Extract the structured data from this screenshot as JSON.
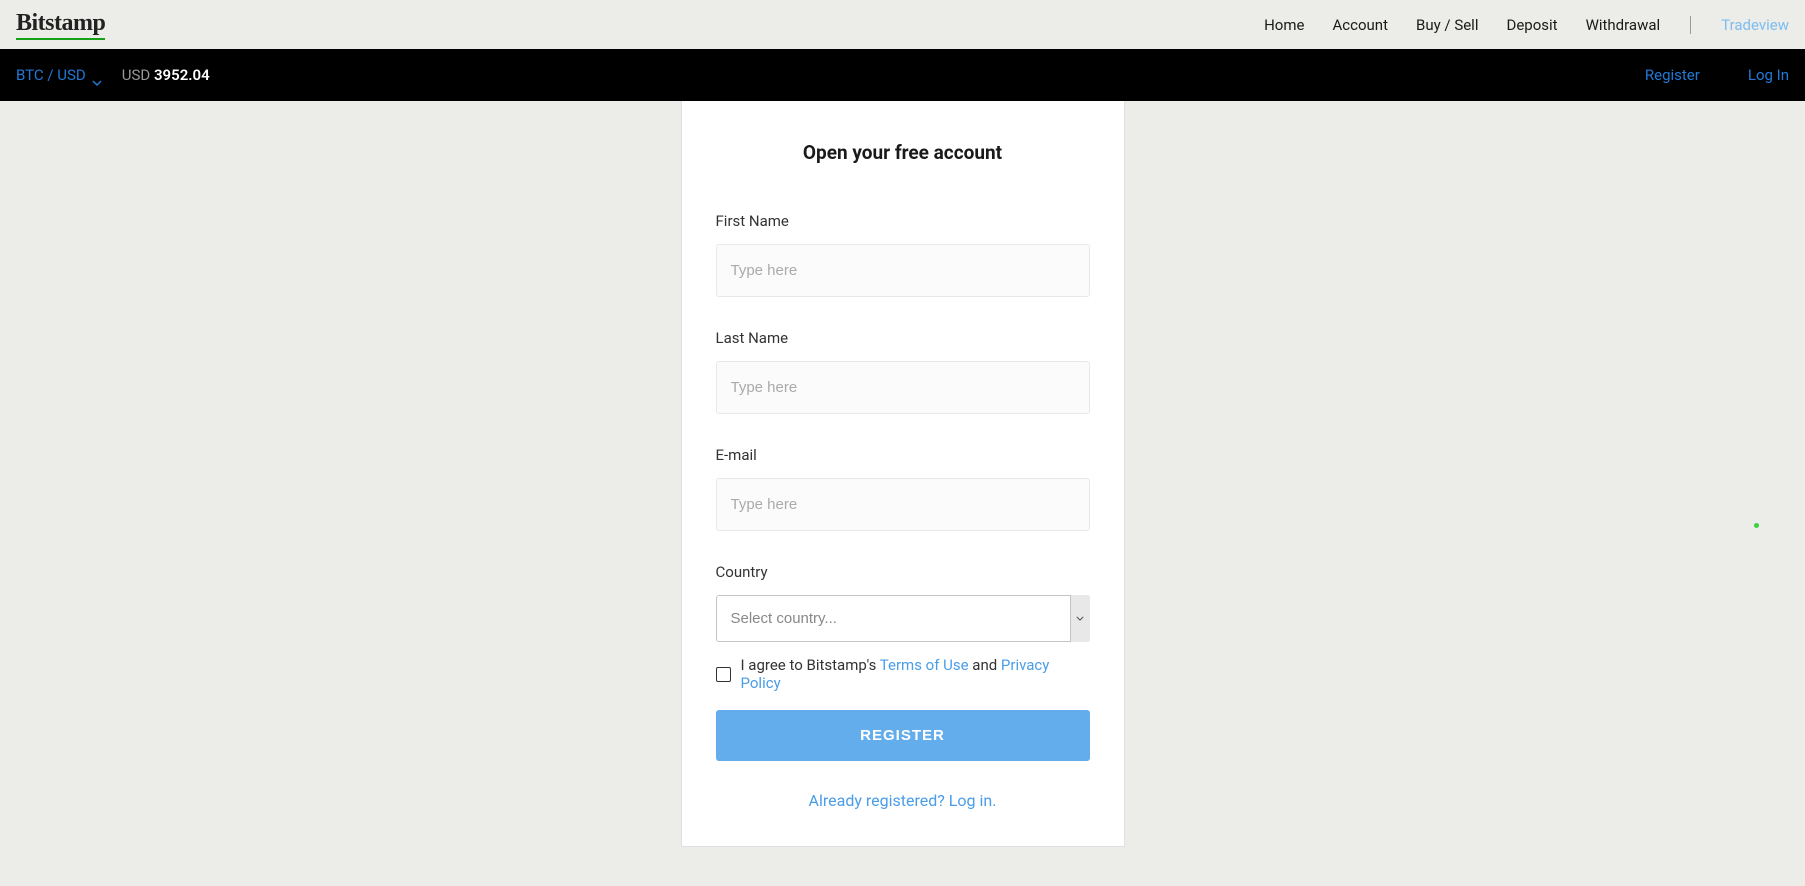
{
  "brand": "Bitstamp",
  "topNav": {
    "home": "Home",
    "account": "Account",
    "buysell": "Buy / Sell",
    "deposit": "Deposit",
    "withdrawal": "Withdrawal",
    "tradeview": "Tradeview"
  },
  "subNav": {
    "pair": "BTC / USD",
    "currency": "USD",
    "price": "3952.04",
    "register": "Register",
    "login": "Log In"
  },
  "form": {
    "title": "Open your free account",
    "firstName": {
      "label": "First Name",
      "placeholder": "Type here"
    },
    "lastName": {
      "label": "Last Name",
      "placeholder": "Type here"
    },
    "email": {
      "label": "E-mail",
      "placeholder": "Type here"
    },
    "country": {
      "label": "Country",
      "placeholder": "Select country..."
    },
    "agree": {
      "prefix": "I agree to Bitstamp's ",
      "terms": "Terms of Use",
      "and": " and ",
      "privacy": "Privacy Policy"
    },
    "submit": "REGISTER",
    "loginPrompt": "Already registered? Log in."
  }
}
